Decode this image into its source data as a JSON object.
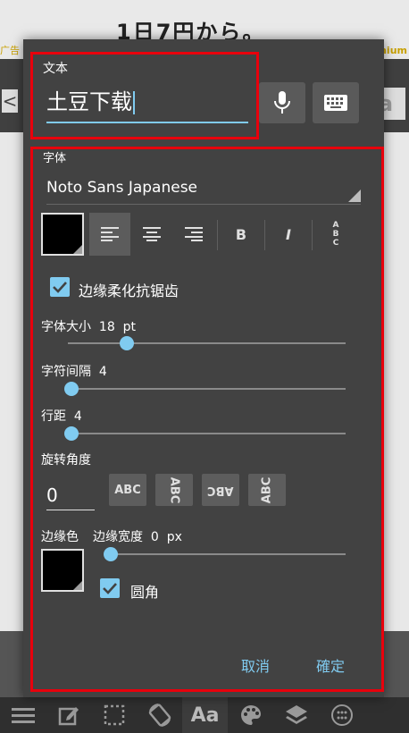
{
  "background": {
    "banner_text": "1日7円から。",
    "ad_label": "广告",
    "premium_label": "mium",
    "back_glyph": "<",
    "side_aa": "a"
  },
  "dialog": {
    "text_section": {
      "label": "文本",
      "value": "土豆下载"
    },
    "mic_button": {
      "icon": "microphone-icon"
    },
    "keyboard_button": {
      "icon": "keyboard-icon"
    },
    "font_section": {
      "label": "字体",
      "font_name": "Noto Sans Japanese"
    },
    "format_buttons": [
      {
        "name": "align-left",
        "glyph": "≡",
        "selected": true
      },
      {
        "name": "align-center",
        "glyph": "≡"
      },
      {
        "name": "align-right",
        "glyph": "≡"
      },
      {
        "name": "bold",
        "glyph": "B"
      },
      {
        "name": "italic",
        "glyph": "I"
      },
      {
        "name": "vertical",
        "glyph": "A B C"
      }
    ],
    "antialias": {
      "label": "边缘柔化抗锯齿",
      "checked": true
    },
    "font_size": {
      "label": "字体大小",
      "value": "18",
      "unit": "pt",
      "level": 0.2
    },
    "char_spacing": {
      "label": "字符间隔",
      "value": "4",
      "level": 0.0
    },
    "line_spacing": {
      "label": "行距",
      "value": "4",
      "level": 0.0
    },
    "rotation": {
      "label": "旋转角度",
      "value": "0",
      "buttons": [
        "ABC",
        "ABC",
        "ABC",
        "ABC"
      ]
    },
    "stroke": {
      "color_label": "边缘色",
      "width_label": "边缘宽度",
      "width_value": "0",
      "unit": "px",
      "level": 0.0
    },
    "round_corner": {
      "label": "圆角",
      "checked": true
    },
    "cancel_label": "取消",
    "ok_label": "確定"
  },
  "bottom_bar": [
    {
      "name": "menu-icon"
    },
    {
      "name": "edit-icon"
    },
    {
      "name": "select-icon"
    },
    {
      "name": "rotate-icon"
    },
    {
      "name": "text-icon",
      "label": "Aa"
    },
    {
      "name": "palette-icon"
    },
    {
      "name": "layers-icon"
    },
    {
      "name": "more-icon"
    }
  ],
  "colors": {
    "accent": "#80cbf0",
    "highlight_border": "#e8000c",
    "dialog_bg": "#424242"
  }
}
